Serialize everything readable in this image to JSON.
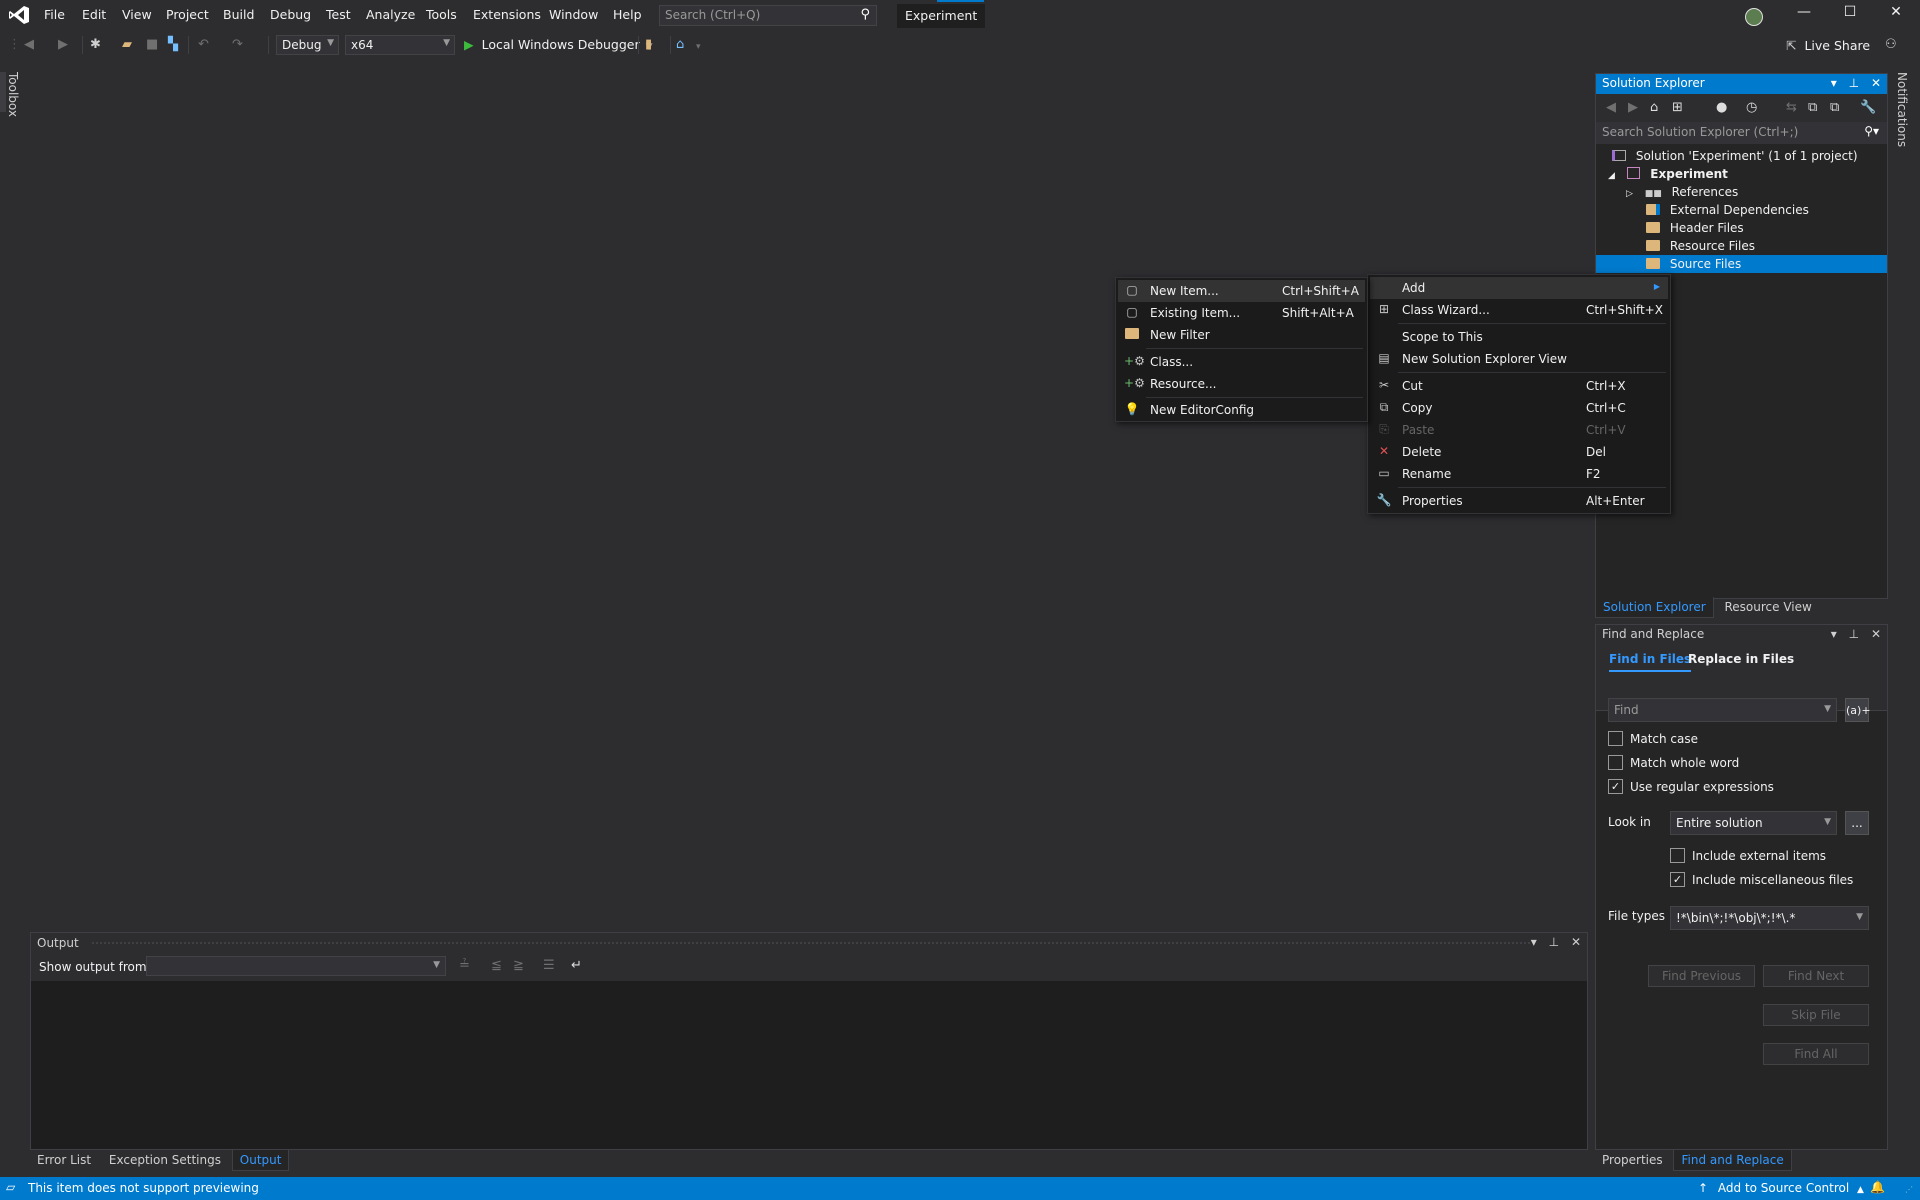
{
  "menubar": {
    "items": [
      "File",
      "Edit",
      "View",
      "Project",
      "Build",
      "Debug",
      "Test",
      "Analyze",
      "Tools",
      "Extensions",
      "Window",
      "Help"
    ],
    "search_placeholder": "Search (Ctrl+Q)",
    "solution_title": "Experiment"
  },
  "window_controls": {
    "minimize": "—",
    "maximize": "☐",
    "close": "✕"
  },
  "toolbar": {
    "configuration": "Debug",
    "platform": "x64",
    "debugger_label": "Local Windows Debugger",
    "live_share": "Live Share"
  },
  "side_tabs": {
    "toolbox": "Toolbox",
    "notifications": "Notifications"
  },
  "solution_explorer": {
    "title": "Solution Explorer",
    "search_placeholder": "Search Solution Explorer (Ctrl+;)",
    "tree": [
      {
        "label": "Solution 'Experiment' (1 of 1 project)",
        "type": "solution"
      },
      {
        "label": "Experiment",
        "type": "project",
        "expanded": true
      },
      {
        "label": "References",
        "type": "references",
        "expanded": false
      },
      {
        "label": "External Dependencies",
        "type": "filter"
      },
      {
        "label": "Header Files",
        "type": "filter"
      },
      {
        "label": "Resource Files",
        "type": "filter"
      },
      {
        "label": "Source Files",
        "type": "filter",
        "selected": true
      }
    ],
    "bottom_tabs": [
      {
        "label": "Solution Explorer",
        "active": true
      },
      {
        "label": "Resource View",
        "active": false
      }
    ]
  },
  "context_menu": {
    "items": [
      {
        "label": "Add",
        "shortcut": "",
        "icon": "",
        "submenu": true,
        "highlighted": true
      },
      {
        "label": "Class Wizard...",
        "shortcut": "Ctrl+Shift+X",
        "icon": "class-wizard"
      },
      {
        "label": "Scope to This",
        "shortcut": "",
        "icon": ""
      },
      {
        "label": "New Solution Explorer View",
        "shortcut": "",
        "icon": "new-view"
      },
      {
        "label": "Cut",
        "shortcut": "Ctrl+X",
        "icon": "scissors"
      },
      {
        "label": "Copy",
        "shortcut": "Ctrl+C",
        "icon": "copy"
      },
      {
        "label": "Paste",
        "shortcut": "Ctrl+V",
        "icon": "paste",
        "disabled": true
      },
      {
        "label": "Delete",
        "shortcut": "Del",
        "icon": "delete"
      },
      {
        "label": "Rename",
        "shortcut": "F2",
        "icon": "rename"
      },
      {
        "label": "Properties",
        "shortcut": "Alt+Enter",
        "icon": "wrench"
      }
    ]
  },
  "add_submenu": {
    "items": [
      {
        "label": "New Item...",
        "shortcut": "Ctrl+Shift+A",
        "icon": "new-item",
        "highlighted": true
      },
      {
        "label": "Existing Item...",
        "shortcut": "Shift+Alt+A",
        "icon": "existing-item"
      },
      {
        "label": "New Filter",
        "shortcut": "",
        "icon": "new-filter"
      },
      {
        "label": "Class...",
        "shortcut": "",
        "icon": "class"
      },
      {
        "label": "Resource...",
        "shortcut": "",
        "icon": "resource"
      },
      {
        "label": "New EditorConfig",
        "shortcut": "",
        "icon": "editorconfig"
      }
    ]
  },
  "find_replace": {
    "title": "Find and Replace",
    "tabs": [
      {
        "label": "Find in Files",
        "active": true
      },
      {
        "label": "Replace in Files",
        "active": false
      }
    ],
    "find_placeholder": "Find",
    "regex_button": "(a)+",
    "options": {
      "match_case": {
        "label": "Match case",
        "checked": false
      },
      "match_whole_word": {
        "label": "Match whole word",
        "checked": false
      },
      "use_regex": {
        "label": "Use regular expressions",
        "checked": true
      }
    },
    "look_in_label": "Look in",
    "look_in_value": "Entire solution",
    "browse_button": "...",
    "include_external": {
      "label": "Include external items",
      "checked": false
    },
    "include_misc": {
      "label": "Include miscellaneous files",
      "checked": true
    },
    "file_types_label": "File types",
    "file_types_value": "!*\\bin\\*;!*\\obj\\*;!*\\.*",
    "buttons": {
      "find_previous": "Find Previous",
      "find_next": "Find Next",
      "skip_file": "Skip File",
      "find_all": "Find All"
    },
    "bottom_tabs": [
      {
        "label": "Properties",
        "active": false
      },
      {
        "label": "Find and Replace",
        "active": true
      }
    ]
  },
  "output": {
    "title": "Output",
    "show_output_from_label": "Show output from:",
    "show_output_from_value": "",
    "bottom_tabs": [
      {
        "label": "Error List",
        "active": false
      },
      {
        "label": "Exception Settings",
        "active": false
      },
      {
        "label": "Output",
        "active": true
      }
    ]
  },
  "status_bar": {
    "message": "This item does not support previewing",
    "source_control": "Add to Source Control"
  },
  "colors": {
    "accent": "#007acc",
    "link": "#3399ff",
    "folder": "#dcb67a",
    "delete": "#e05252",
    "run": "#3dbb3d"
  }
}
